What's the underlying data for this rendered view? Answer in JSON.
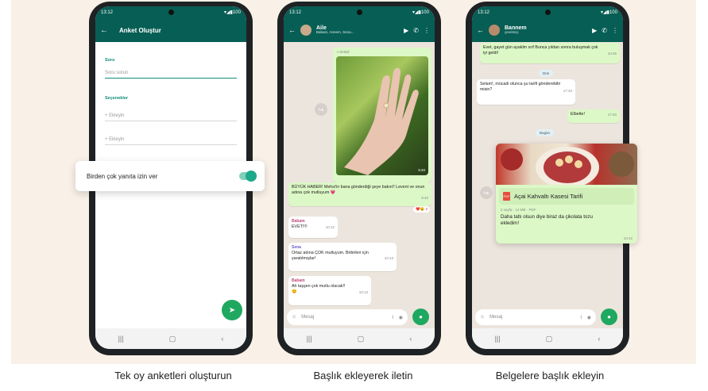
{
  "status": {
    "time": "13:12",
    "icons": "▾◢▮100"
  },
  "phone1": {
    "title": "Anket Oluştur",
    "question_label": "Soru",
    "question_placeholder": "Soru sorun",
    "options_label": "Seçenekler",
    "option_placeholders": [
      "+ Ekleyin",
      "+ Ekleyin"
    ],
    "toggle_label": "Birden çok yanıta izin ver",
    "toggle_on": true
  },
  "phone2": {
    "contact_name": "Aile",
    "contact_sub": "Babam, Annem, Sena...",
    "forwarded_label": "↪ İletildi",
    "image_time": "9:40",
    "caption_text": "BÜYÜK HABER! Mehsi'in bana gönderdiği şeye bakın!! Levent ve onun adına çok mutluyum 💗",
    "caption_time": "9:40",
    "reaction": "❤️😮 2",
    "messages": [
      {
        "sender": "Babam",
        "text": "EVET!!!!",
        "time": "10:12"
      },
      {
        "sender": "Sena",
        "text": "Ortaz adına ÇOK mutluyum. Birbirleri için yaratılmışlar!",
        "time": "10:13"
      },
      {
        "sender": "Babam",
        "text": "Ah taşşen çok mutlu olacak!! 😊",
        "time": "10:13"
      }
    ],
    "composer_placeholder": "Mesaj"
  },
  "phone3": {
    "contact_name": "Bannem",
    "contact_sub": "çevrimiçi",
    "top_text": "Evet, gayet gün ayaklm sırf Bunca yıldan sonra buluşmak çok iyi geldi!",
    "top_time": "10:45",
    "day_chip_1": "Dün",
    "question_text": "Selam!, mücadi olunca şu tarifi gönderebilir misin?",
    "question_time": "17:33",
    "reply_text": "Elbette!",
    "reply_time": "17:40",
    "day_chip_2": "Bugün",
    "doc_title": "Açai Kahvaltı Kasesi Tarifi",
    "doc_meta": "2 sayfa · 12 MB · PDF",
    "doc_caption": "Daha tatlı olsun diye biraz da çikolata tozu ekledim!",
    "doc_time": "10:12",
    "composer_placeholder": "Mesaj"
  },
  "captions": [
    "Tek oy anketleri oluşturun",
    "Başlık ekleyerek iletin",
    "Belgelere başlık ekleyin"
  ],
  "colors": {
    "header_green": "#075e54",
    "accent": "#1fa85f",
    "out_bubble": "#dcf8c6",
    "panel_bg": "#f9f1e7"
  }
}
